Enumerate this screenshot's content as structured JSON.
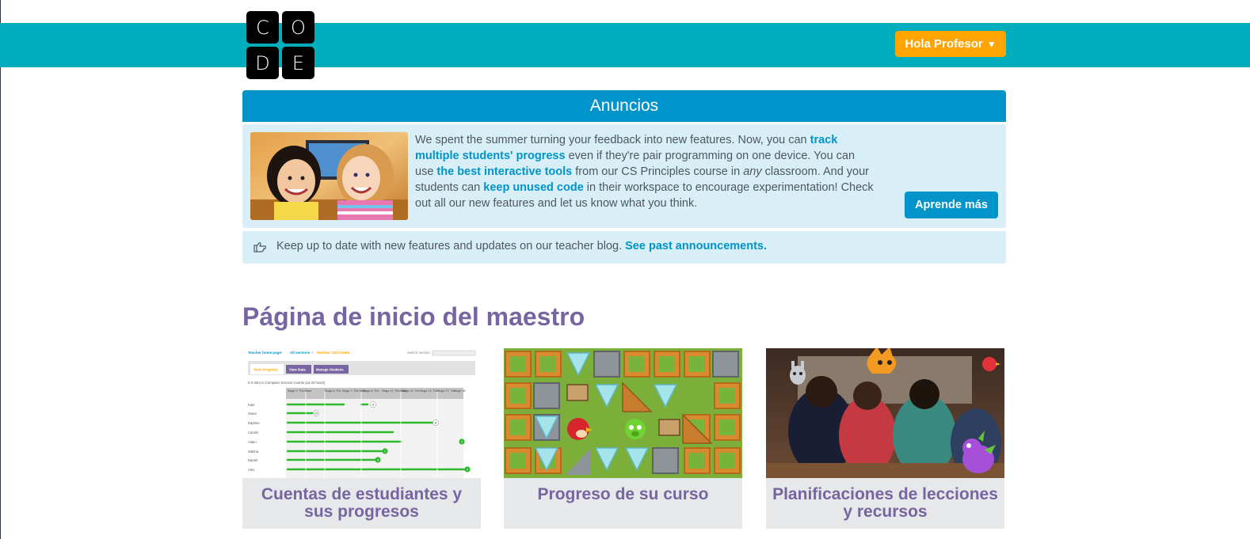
{
  "header": {
    "logo_letters": [
      "C",
      "O",
      "D",
      "E"
    ],
    "user_menu_label": "Hola Profesor",
    "user_menu_caret": "▼"
  },
  "announcements": {
    "title": "Anuncios",
    "text_1": "We spent the summer turning your feedback into new features. Now, you can ",
    "link_1": "track multiple students' progress",
    "text_2": " even if they're pair programming on one device. You can use ",
    "link_2": "the best interactive tools",
    "text_3": " from our CS Principles course in ",
    "text_3_em": "any",
    "text_4": " classroom. And your students can ",
    "link_3": "keep unused code",
    "text_5": " in their workspace to encourage experimentation! Check out all our new features and let us know what you think.",
    "learn_more_label": "Aprende más"
  },
  "blog": {
    "icon": "hand-pointing-right-icon",
    "text": "Keep up to date with new features and updates on our teacher blog. ",
    "link": "See past announcements."
  },
  "page_title": "Página de inicio del maestro",
  "cards": [
    {
      "caption": "Cuentas de estudiantes y sus progresos",
      "screenshot": {
        "breadcrumb": [
          "Teacher home page",
          "All sections",
          "Section: 2nd Grade"
        ],
        "switch_section": "Switch section:",
        "tabs": [
          "View Progress",
          "View Stats",
          "Manage Students"
        ],
        "course": "K-5 Intro to Computer Science Course (13-23 hours)",
        "stage_headers": [
          "Stage 2: The Maze",
          "Stage 6: The",
          "Stage 7: The Artist",
          "Stage 8: The",
          "Stage 11: The Artist",
          "Stage 12: The",
          "Stage 13: The",
          "Stage 17: The",
          "Stage 18:"
        ],
        "students": [
          "Kate",
          "Owen",
          "Daphne",
          "Carolin",
          "Aiden",
          "Sabina",
          "Daniel",
          "Alex"
        ],
        "level_badges": [
          "6",
          "10",
          "8",
          "2",
          "1",
          "3",
          "4"
        ]
      }
    },
    {
      "caption": "Progreso de su curso",
      "image": "angry-birds-maze-game"
    },
    {
      "caption": "Planificaciones de lecciones y recursos",
      "image": "students-classroom-photo"
    }
  ],
  "colors": {
    "teal": "#00adbc",
    "orange": "#ffa400",
    "blue": "#0094ca",
    "light_blue": "#d9eff7",
    "purple": "#7665a0",
    "card_bg": "#e7e8ea"
  }
}
